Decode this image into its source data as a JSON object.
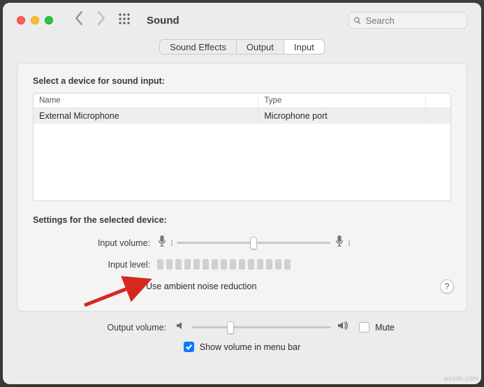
{
  "window": {
    "title": "Sound"
  },
  "search": {
    "placeholder": "Search"
  },
  "tabs": {
    "items": [
      {
        "label": "Sound Effects",
        "active": false
      },
      {
        "label": "Output",
        "active": false
      },
      {
        "label": "Input",
        "active": true
      }
    ]
  },
  "panel": {
    "select_label": "Select a device for sound input:",
    "columns": {
      "name": "Name",
      "type": "Type"
    },
    "rows": [
      {
        "name": "External Microphone",
        "type": "Microphone port"
      }
    ],
    "settings_label": "Settings for the selected device:",
    "input_volume": {
      "label": "Input volume:",
      "value_pct": 50
    },
    "input_level": {
      "label": "Input level:",
      "bars": 15
    },
    "ambient": {
      "label": "Use ambient noise reduction",
      "checked": true
    },
    "help": "?"
  },
  "bottom": {
    "output_volume": {
      "label": "Output volume:",
      "value_pct": 28
    },
    "mute": {
      "label": "Mute",
      "checked": false
    },
    "menubar": {
      "label": "Show volume in menu bar",
      "checked": true
    }
  },
  "watermark": "wsxdn.com"
}
